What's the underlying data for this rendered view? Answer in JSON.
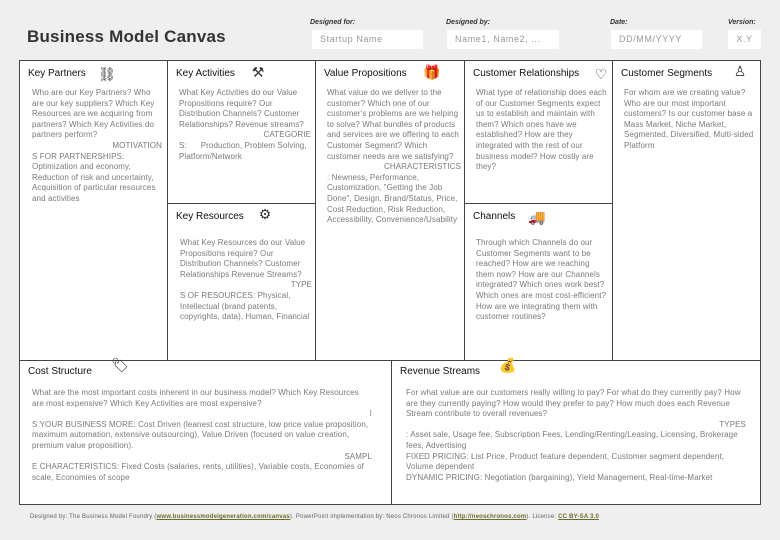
{
  "header": {
    "title": "Business Model Canvas",
    "designed_for": {
      "label": "Designed for:",
      "value": "Startup Name"
    },
    "designed_by": {
      "label": "Designed by:",
      "value": "Name1, Name2, ..."
    },
    "date": {
      "label": "Date:",
      "value": "DD/MM/YYYY"
    },
    "version": {
      "label": "Version:",
      "value": "X.Y"
    }
  },
  "blocks": {
    "key_partners": {
      "title": "Key Partners",
      "icon": "chain-links-icon",
      "questions": "Who are our Key Partners? Who are our key suppliers? Which Key Resources are we acquiring from partners? Which Key Activities do partners perform?",
      "heading": "MOTIVATION",
      "details": "S FOR PARTNERSHIPS: Optimization and economy, Reduction of risk and uncertainty, Acquisition of particular resources and activities"
    },
    "key_activities": {
      "title": "Key Activities",
      "icon": "worker-icon",
      "questions": "What Key Activities do our Value Propositions require? Our Distribution Channels? Customer Relationships? Revenue streams?",
      "heading": "CATEGORIE",
      "details": "S:      Production, Problem Solving, Platform/Network"
    },
    "key_resources": {
      "title": "Key Resources",
      "icon": "factory-worker-icon",
      "questions": "What Key Resources do our Value Propositions require? Our Distribution Channels? Customer Relationships Revenue Streams?",
      "heading": "TYPE",
      "details": "S OF RESOURCES: Physical, Intellectual (brand patents, copyrights, data), Human, Financial"
    },
    "value_propositions": {
      "title": "Value Propositions",
      "icon": "gift-icon",
      "questions": "What value do we deliver to the customer? Which one of our customer's problems are we helping to solve? What bundles of products and services are we offering to each Customer Segment? Which customer needs are we satisfying?",
      "heading": "CHARACTERISTICS",
      "details": ": Newness, Performance, Customization, \"Getting the Job Done\", Design, Brand/Status, Price, Cost Reduction, Risk Reduction, Accessibility, Convenience/Usability"
    },
    "customer_relationships": {
      "title": "Customer Relationships",
      "icon": "heart-icon",
      "questions": "What type of relationship does each of our Customer Segments expect us to establish and maintain with them? Which ones have we established? How are they integrated with the rest of our business model? How costly are they?"
    },
    "channels": {
      "title": "Channels",
      "icon": "truck-icon",
      "questions": "Through which Channels do our Customer Segments want to be reached? How are we reaching them now? How are our Channels integrated? Which ones work best? Which ones are most cost-efficient? How are we integrating them with customer routines?"
    },
    "customer_segments": {
      "title": "Customer Segments",
      "icon": "person-sitting-icon",
      "questions": "For whom are we creating value? Who are our most important customers? Is our customer base a Mass Market, Niche Market, Segmented, Diversified, Multi-sided Platform"
    },
    "cost_structure": {
      "title": "Cost Structure",
      "icon": "price-tag-icon",
      "questions": "What are the most important costs inherent in our business model? Which Key Resources are most expensive? Which Key Activities are most expensive?",
      "heading1": "I",
      "details1": "S YOUR BUSINESS MORE: Cost Driven (leanest cost structure, low price value proposition, maximum automation, extensive outsourcing), Value Driven (focused on value creation, premium value proposition).",
      "heading2": "SAMPL",
      "details2": "E CHARACTERISTICS: Fixed Costs (salaries, rents, utilities), Variable costs, Economies of scale, Economies of scope"
    },
    "revenue_streams": {
      "title": "Revenue Streams",
      "icon": "money-bag-icon",
      "questions": "For what value are our customers really willing to pay? For what do they currently pay? How are they currently paying? How would they prefer to pay? How much does each Revenue Stream contribute to overall revenues?",
      "heading": "TYPES",
      "details1": ": Asset sale, Usage fee, Subscription Fees, Lending/Renting/Leasing, Licensing, Brokerage fees, Advertising",
      "details2": "FIXED PRICING: List Price, Product feature dependent, Customer segment dependent, Volume dependent",
      "details3": "DYNAMIC PRICING: Negotiation (bargaining), Yield Management, Real-time-Market"
    }
  },
  "footer": {
    "designed_by_text": "Designed by: The Business Model Foundry (",
    "link1": "www.businessmodelgeneration.com/canvas",
    "mid_text": "). PowerPoint implementation by: Neos Chronos Limited (",
    "link2": "http://neoschronos.com",
    "license_text": "). License: ",
    "link3": "CC BY-SA 3.0"
  }
}
